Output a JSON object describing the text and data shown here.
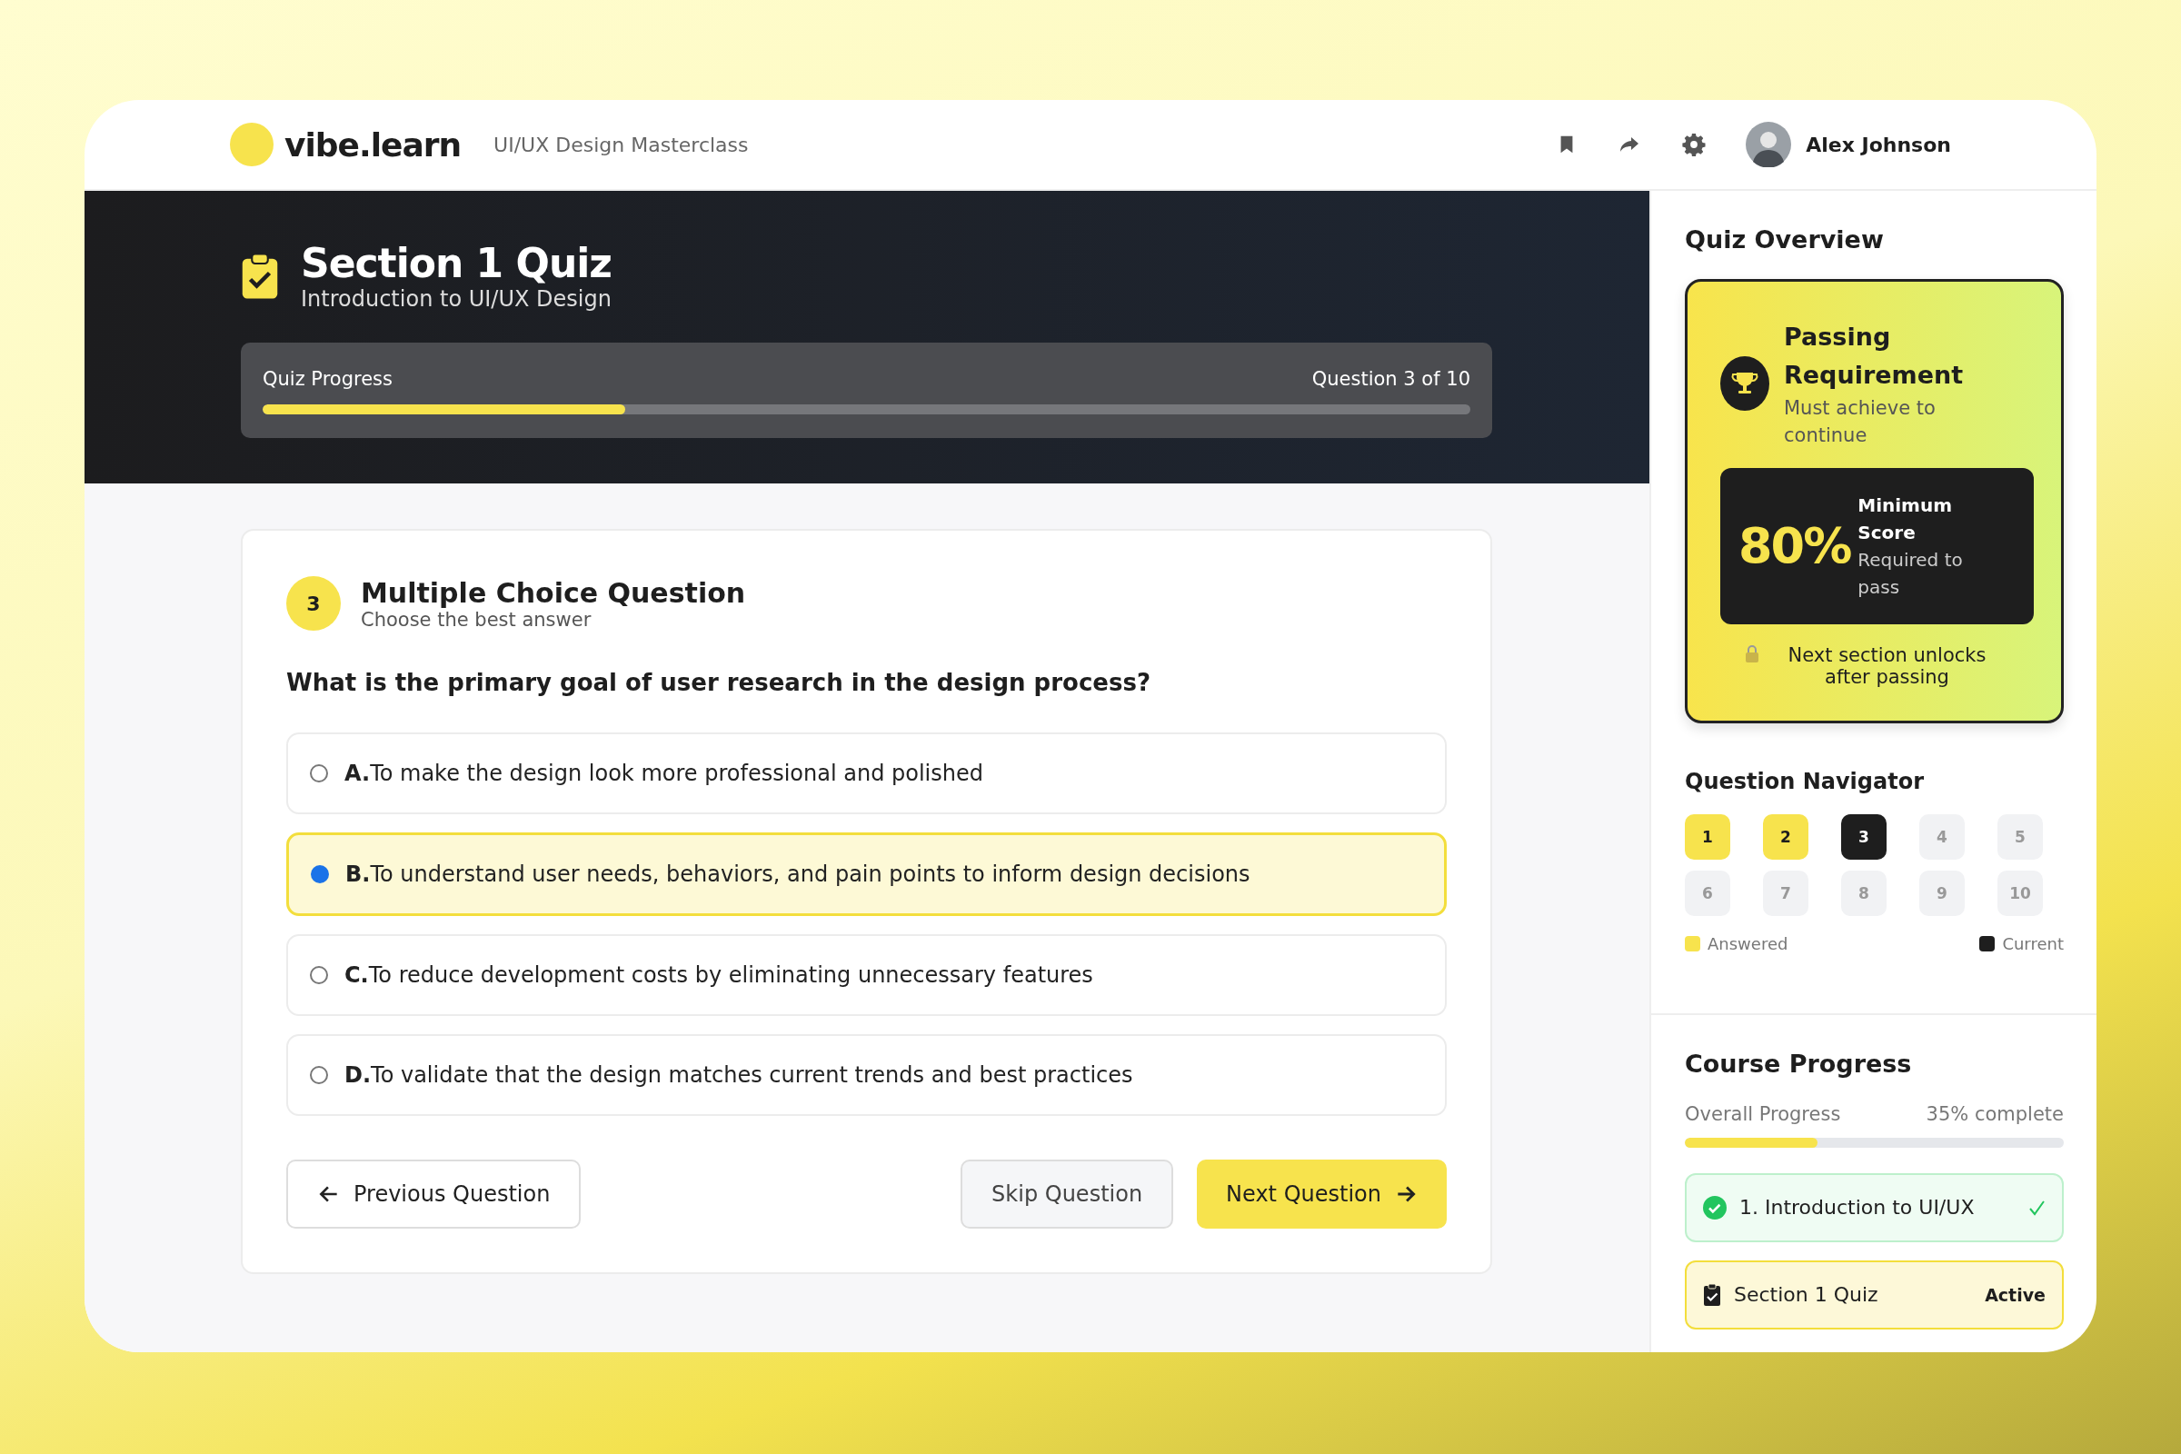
{
  "header": {
    "logo": "vibe.learn",
    "course": "UI/UX Design Masterclass",
    "user": "Alex Johnson"
  },
  "hero": {
    "title": "Section 1 Quiz",
    "subtitle": "Introduction to UI/UX Design",
    "progress_label": "Quiz Progress",
    "progress_reading": "Question 3 of 10",
    "level": 0.3
  },
  "question": {
    "number": "3",
    "type": "Multiple Choice Question",
    "hint": "Choose the best answer",
    "text": "What is the primary goal of user research in the design process?",
    "options": [
      {
        "letter": "A.",
        "text": "To make the design look more professional and polished",
        "selected": false
      },
      {
        "letter": "B.",
        "text": "To understand user needs, behaviors, and pain points to inform design decisions",
        "selected": true
      },
      {
        "letter": "C.",
        "text": "To reduce development costs by eliminating unnecessary features",
        "selected": false
      },
      {
        "letter": "D.",
        "text": "To validate that the design matches current trends and best practices",
        "selected": false
      }
    ]
  },
  "buttons": [
    {
      "label": "Previous Question",
      "kind": "back"
    },
    {
      "label": "Skip Question",
      "kind": "skip"
    },
    {
      "label": "Next Question",
      "kind": "next"
    }
  ],
  "overview": {
    "title": "Quiz Overview",
    "heading": "Passing Requirement",
    "sub": "Must achieve to continue",
    "score": "80%",
    "score_title": "Minimum Score",
    "score_sub": "Required to pass",
    "note": "Next section unlocks after passing"
  },
  "navigator": {
    "title": "Question Navigator",
    "items": [
      {
        "label": "1",
        "answered": true,
        "selected": false
      },
      {
        "label": "2",
        "answered": true,
        "selected": false
      },
      {
        "label": "3",
        "answered": false,
        "selected": true
      },
      {
        "label": "4",
        "answered": false,
        "selected": false
      },
      {
        "label": "5",
        "answered": false,
        "selected": false
      },
      {
        "label": "6",
        "answered": false,
        "selected": false
      },
      {
        "label": "7",
        "answered": false,
        "selected": false
      },
      {
        "label": "8",
        "answered": false,
        "selected": false
      },
      {
        "label": "9",
        "answered": false,
        "selected": false
      },
      {
        "label": "10",
        "answered": false,
        "selected": false
      }
    ],
    "legend": [
      {
        "label": "Answered",
        "color": "#f7e34d"
      },
      {
        "label": "Current",
        "color": "#1e1e1e"
      }
    ]
  },
  "course_progress": {
    "title": "Course Progress",
    "label": "Overall Progress",
    "reading": "35% complete",
    "level": 0.35,
    "items": [
      {
        "label": "1. Introduction to UI/UX",
        "kind": "done"
      },
      {
        "label": "Section 1 Quiz",
        "kind": "active",
        "badge": "Active"
      }
    ]
  }
}
